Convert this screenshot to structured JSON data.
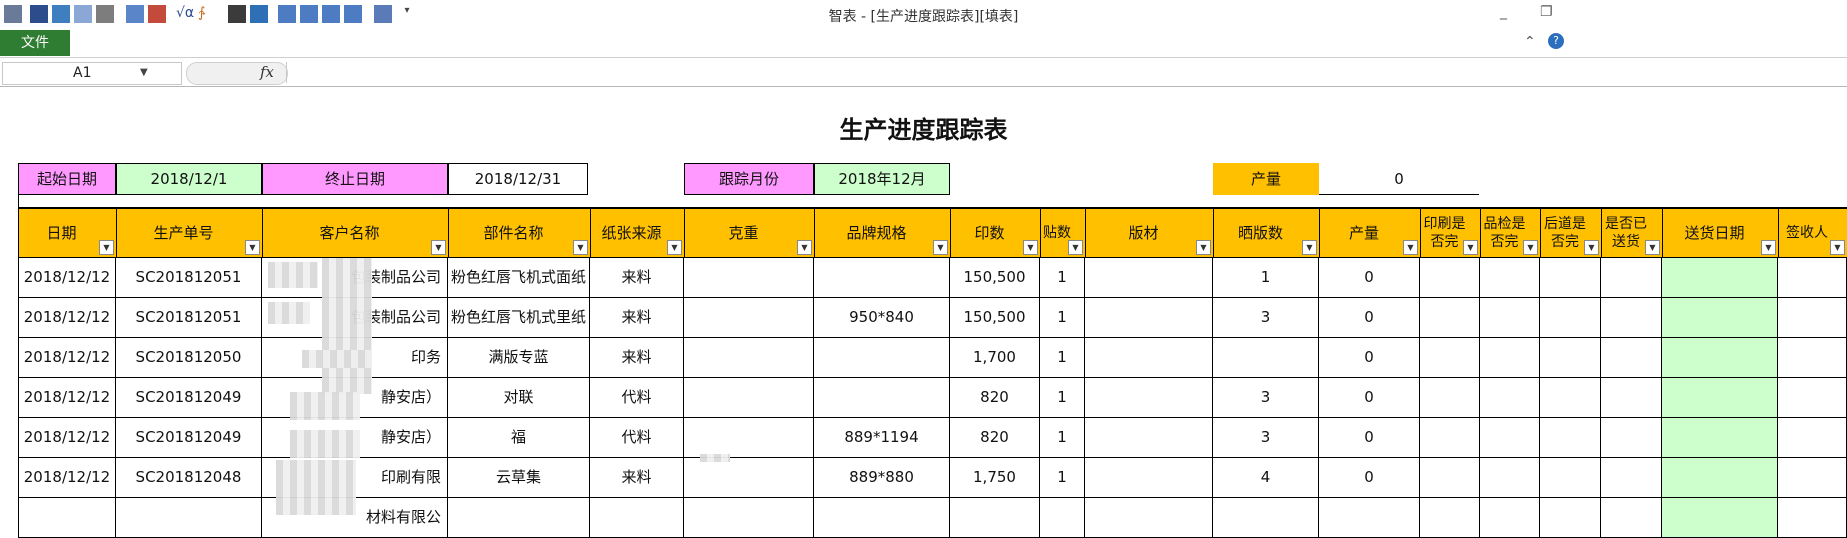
{
  "window": {
    "title": "智表 - [生产进度跟踪表][填表]"
  },
  "ribbon": {
    "file_tab": "文件"
  },
  "formula_bar": {
    "name_box": "A1",
    "fx": "fx",
    "formula": ""
  },
  "sheet": {
    "title": "生产进度跟踪表",
    "filters": {
      "start_label": "起始日期",
      "start_value": "2018/12/1",
      "end_label": "终止日期",
      "end_value": "2018/12/31",
      "month_label": "跟踪月份",
      "month_value": "2018年12月",
      "qty_label": "产量",
      "qty_value": "0"
    },
    "columns": [
      "日期",
      "生产单号",
      "客户名称",
      "部件名称",
      "纸张来源",
      "克重",
      "品牌规格",
      "印数",
      "贴数",
      "版材",
      "晒版数",
      "产量",
      "印刷是否完",
      "品检是否完",
      "后道是否完",
      "是否已送货",
      "送货日期",
      "签收人"
    ],
    "rows": [
      [
        "2018/12/12",
        "SC201812051",
        "包装制品公司",
        "粉色红唇飞机式面纸",
        "来料",
        "",
        "",
        "150,500",
        "1",
        "",
        "1",
        "0",
        "",
        "",
        "",
        "",
        "",
        ""
      ],
      [
        "2018/12/12",
        "SC201812051",
        "包装制品公司",
        "粉色红唇飞机式里纸",
        "来料",
        "",
        "950*840",
        "150,500",
        "1",
        "",
        "3",
        "0",
        "",
        "",
        "",
        "",
        "",
        ""
      ],
      [
        "2018/12/12",
        "SC201812050",
        "印务",
        "满版专蓝",
        "来料",
        "",
        "",
        "1,700",
        "1",
        "",
        "",
        "0",
        "",
        "",
        "",
        "",
        "",
        ""
      ],
      [
        "2018/12/12",
        "SC201812049",
        "静安店）",
        "对联",
        "代料",
        "",
        "",
        "820",
        "1",
        "",
        "3",
        "0",
        "",
        "",
        "",
        "",
        "",
        ""
      ],
      [
        "2018/12/12",
        "SC201812049",
        "静安店）",
        "福",
        "代料",
        "",
        "889*1194",
        "820",
        "1",
        "",
        "3",
        "0",
        "",
        "",
        "",
        "",
        "",
        ""
      ],
      [
        "2018/12/12",
        "SC201812048",
        "印刷有限",
        "云草集",
        "来料",
        "",
        "889*880",
        "1,750",
        "1",
        "",
        "4",
        "0",
        "",
        "",
        "",
        "",
        "",
        ""
      ],
      [
        "",
        "",
        "材料有限公",
        "",
        "",
        "",
        "",
        "",
        "",
        "",
        "",
        "",
        "",
        "",
        "",
        "",
        "",
        ""
      ]
    ]
  }
}
